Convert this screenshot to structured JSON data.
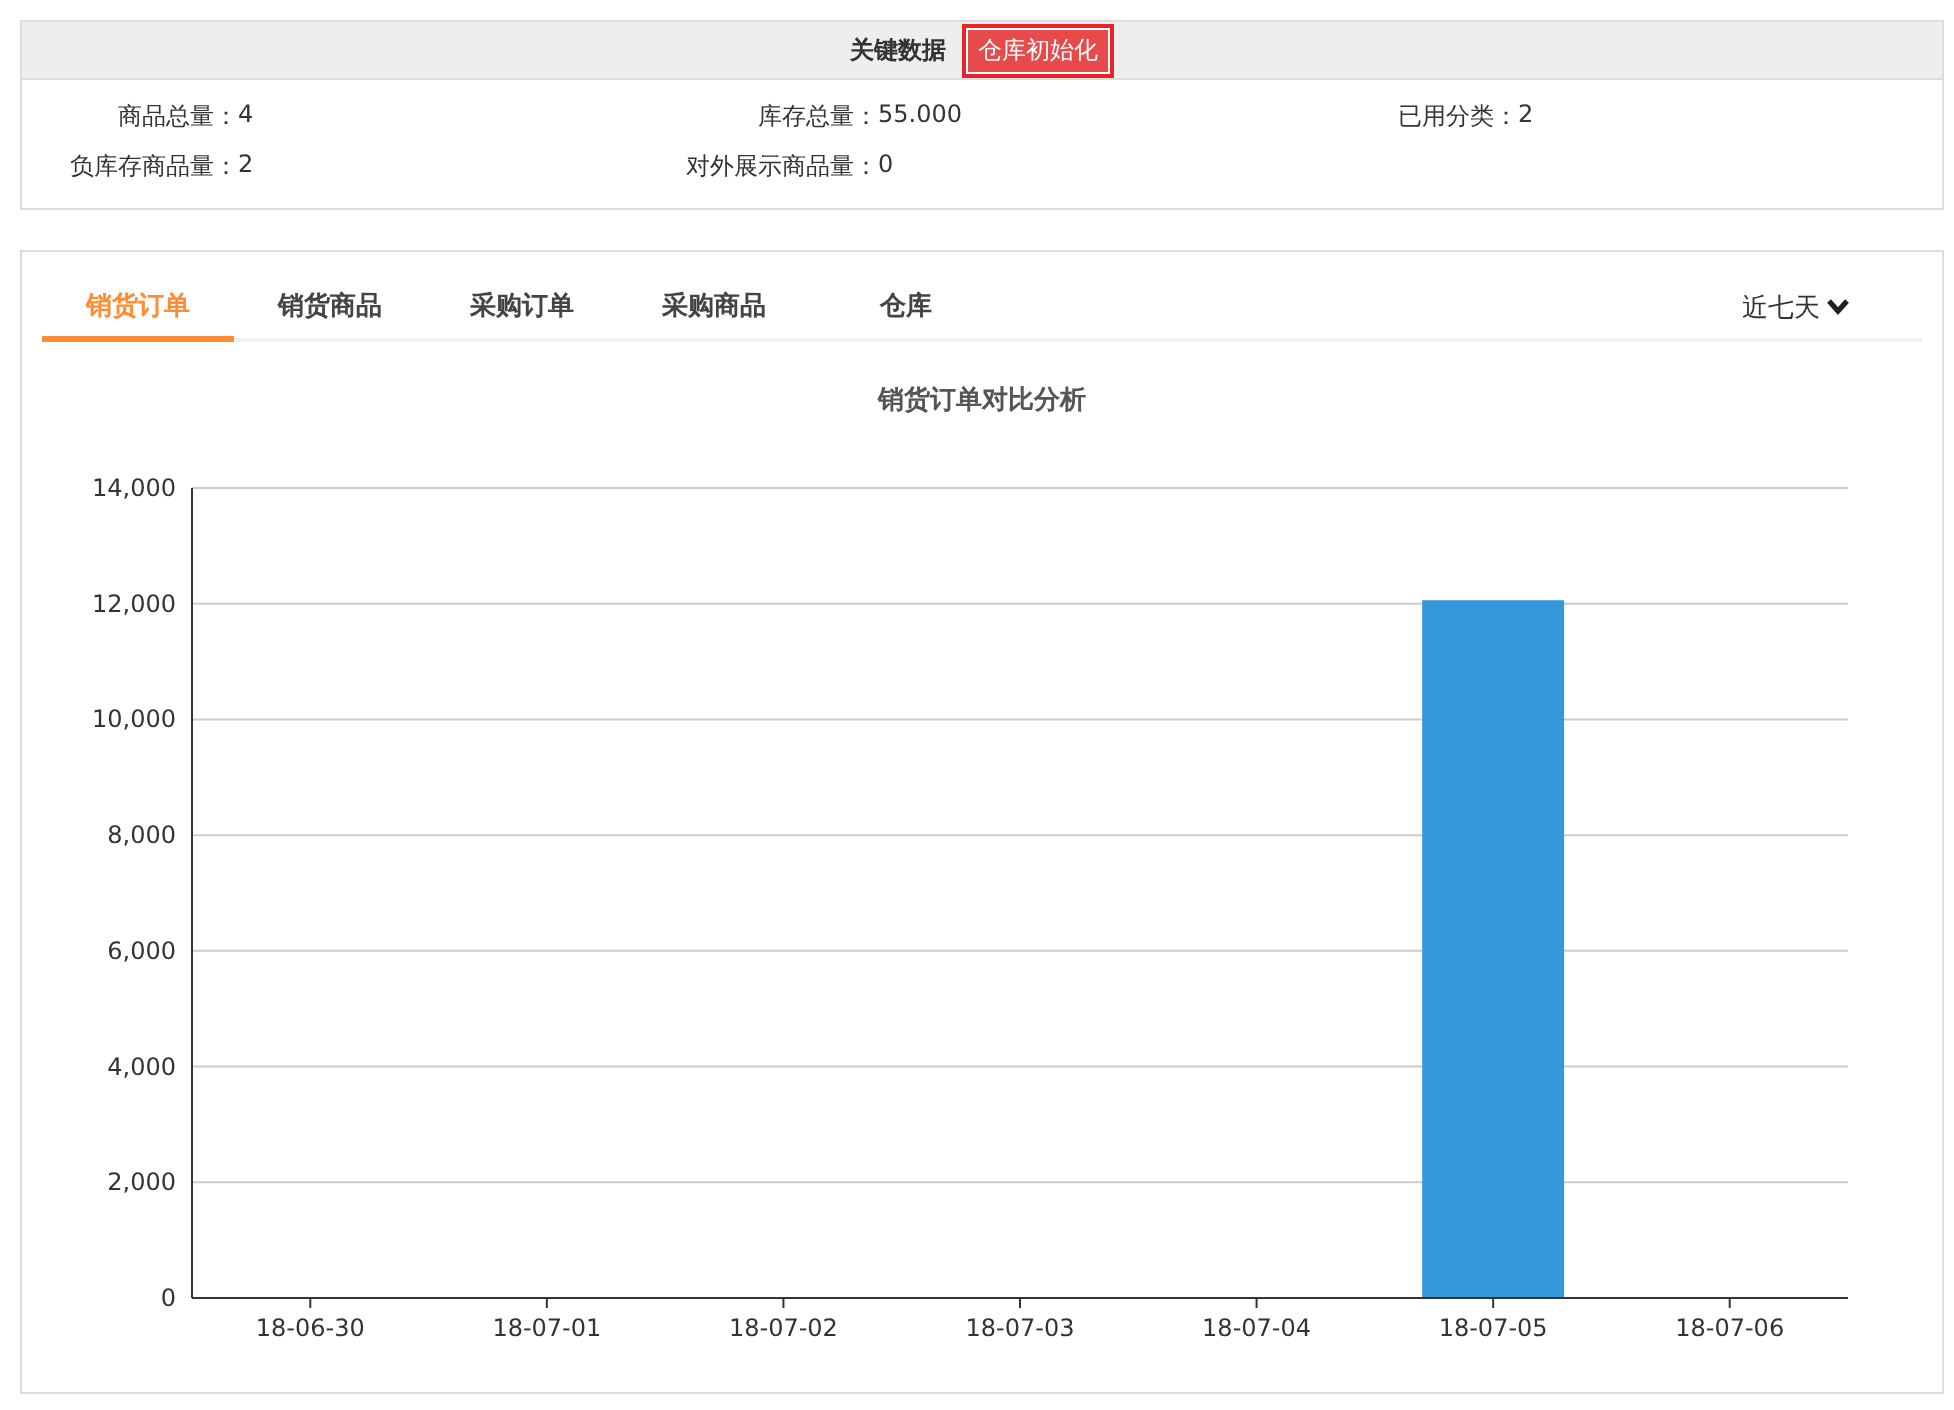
{
  "key_data": {
    "title": "关键数据",
    "init_button": "仓库初始化",
    "stats": [
      {
        "label": "商品总量：",
        "value": "4"
      },
      {
        "label": "库存总量：",
        "value": "55.000"
      },
      {
        "label": "已用分类：",
        "value": "2"
      },
      {
        "label": "负库存商品量：",
        "value": "2"
      },
      {
        "label": "对外展示商品量：",
        "value": "0"
      }
    ]
  },
  "tabs": [
    {
      "label": "销货订单",
      "selected": true
    },
    {
      "label": "销货商品",
      "selected": false
    },
    {
      "label": "采购订单",
      "selected": false
    },
    {
      "label": "采购商品",
      "selected": false
    },
    {
      "label": "仓库",
      "selected": false
    }
  ],
  "period": "近七天",
  "chart_data": {
    "type": "bar",
    "title": "销货订单对比分析",
    "categories": [
      "18-06-30",
      "18-07-01",
      "18-07-02",
      "18-07-03",
      "18-07-04",
      "18-07-05",
      "18-07-06"
    ],
    "series": [
      {
        "color": "#3498db",
        "values": [
          0,
          0,
          0,
          0,
          0,
          12060,
          0
        ]
      }
    ],
    "grid": true,
    "ylim": [
      0,
      14000
    ],
    "yticks": [
      {
        "value": 0,
        "label": "0"
      },
      {
        "value": 2000,
        "label": "2,000"
      },
      {
        "value": 4000,
        "label": "4,000"
      },
      {
        "value": 6000,
        "label": "6,000"
      },
      {
        "value": 8000,
        "label": "8,000"
      },
      {
        "value": 10000,
        "label": "10,000"
      },
      {
        "value": 12000,
        "label": "12,000"
      },
      {
        "value": 14000,
        "label": "14,000"
      }
    ]
  }
}
